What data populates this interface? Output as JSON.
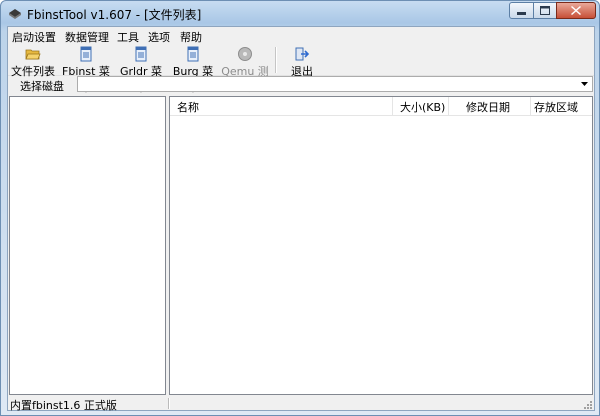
{
  "window": {
    "title": "FbinstTool v1.607 - [文件列表]"
  },
  "menu": [
    "启动设置",
    "数据管理",
    "工具",
    "选项",
    "帮助"
  ],
  "toolbar": {
    "file_list": "文件列表",
    "fbinst_menu": "Fbinst 菜单",
    "grldr_menu": "Grldr 菜单",
    "burg_menu": "Burg 菜单",
    "qemu_test": "Qemu 测试",
    "exit": "退出"
  },
  "disk": {
    "label": "选择磁盘",
    "value": ""
  },
  "list": {
    "columns": [
      "名称",
      "大小(KB)",
      "修改日期",
      "存放区域"
    ],
    "rows": []
  },
  "status": {
    "text": "内置fbinst1.6 正式版"
  },
  "colors": {
    "title_bar": "#a9c7e6",
    "close_button": "#c74f37",
    "client_bg": "#f0f0f0"
  }
}
